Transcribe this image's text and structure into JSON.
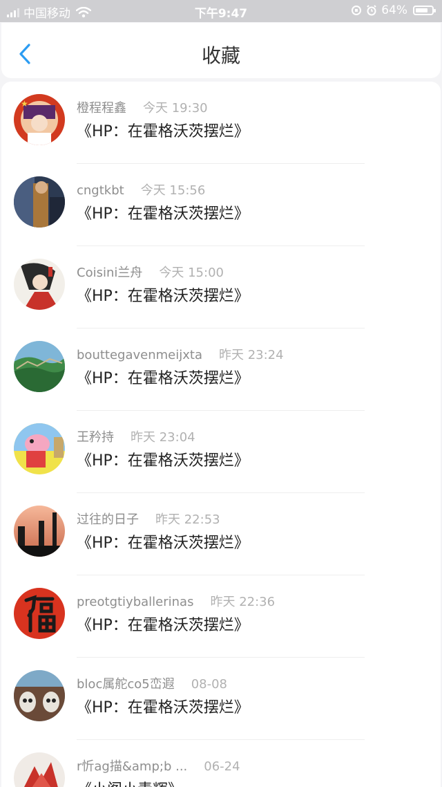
{
  "status_bar": {
    "carrier": "中国移动",
    "time": "下午9:47",
    "battery_percent": "64%",
    "battery_level": 0.64
  },
  "header": {
    "title": "收藏",
    "back_icon": "chevron-left-icon",
    "accent_color": "#2b9cf2"
  },
  "items": [
    {
      "username": "橙程程鑫",
      "time": "今天 19:30",
      "title": "《HP：在霍格沃茨摆烂》"
    },
    {
      "username": "cngtkbt",
      "time": "今天 15:56",
      "title": "《HP：在霍格沃茨摆烂》"
    },
    {
      "username": "Coisini兰舟",
      "time": "今天 15:00",
      "title": "《HP：在霍格沃茨摆烂》"
    },
    {
      "username": "bouttegavenmeijxta",
      "time": "昨天 23:24",
      "title": "《HP：在霍格沃茨摆烂》"
    },
    {
      "username": "王矜持",
      "time": "昨天 23:04",
      "title": "《HP：在霍格沃茨摆烂》"
    },
    {
      "username": "过往的日子",
      "time": "昨天 22:53",
      "title": "《HP：在霍格沃茨摆烂》"
    },
    {
      "username": "preotgtiyballerinas",
      "time": "昨天 22:36",
      "title": "《HP：在霍格沃茨摆烂》"
    },
    {
      "username": "bloc属舵co5峦遐",
      "time": "08-08",
      "title": "《HP：在霍格沃茨摆烂》"
    },
    {
      "username": "r忻ag描&amp;b ...",
      "time": "06-24",
      "title": "《小阁小青辉》"
    }
  ]
}
